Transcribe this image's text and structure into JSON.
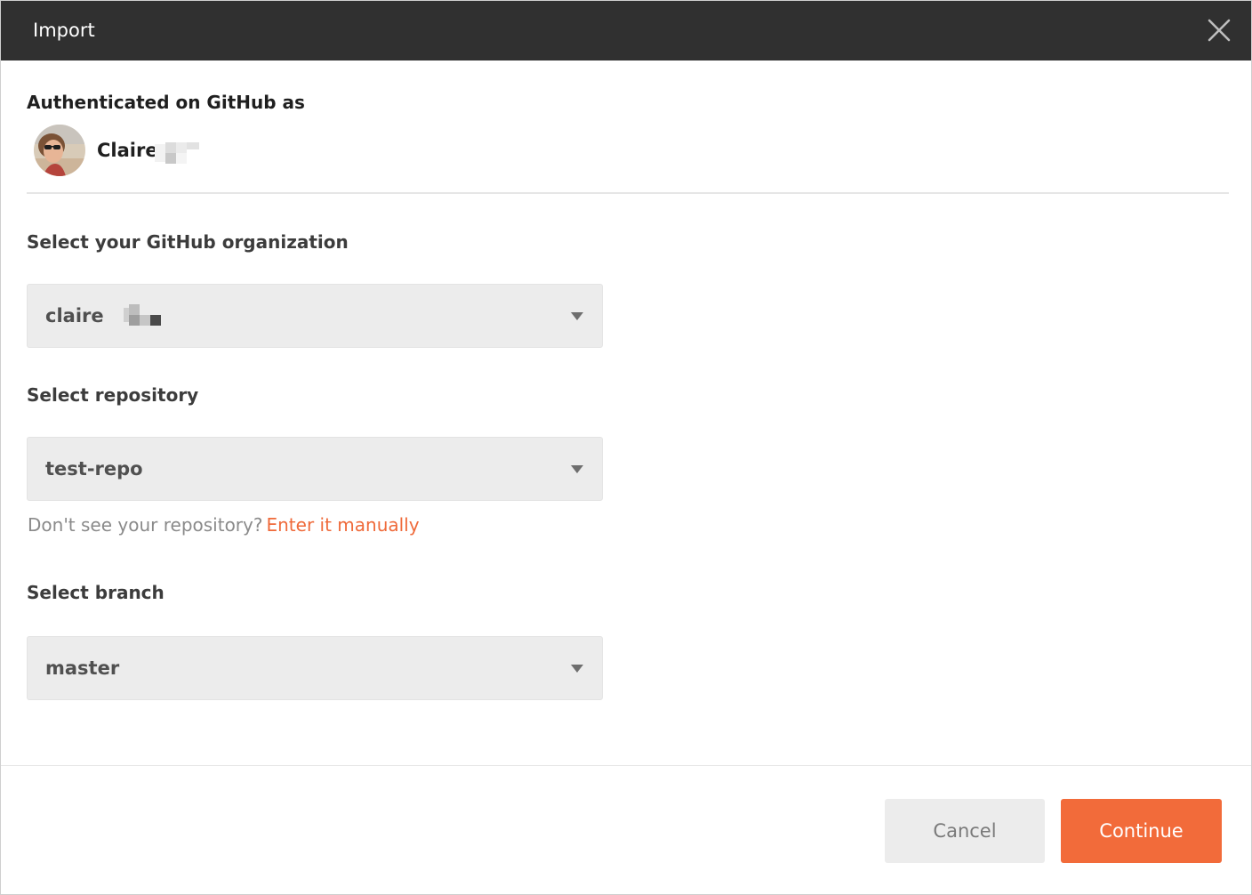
{
  "dialog": {
    "title": "Import",
    "close_icon": "close-icon"
  },
  "auth": {
    "heading": "Authenticated on GitHub as",
    "user_name": "Claire",
    "avatar_icon": "avatar"
  },
  "organization": {
    "label": "Select your GitHub organization",
    "value": "claire"
  },
  "repository": {
    "label": "Select repository",
    "value": "test-repo",
    "hint_text": "Don't see your repository?",
    "hint_link": "Enter it manually"
  },
  "branch": {
    "label": "Select branch",
    "value": "master"
  },
  "footer": {
    "cancel_label": "Cancel",
    "continue_label": "Continue"
  },
  "colors": {
    "titlebar": "#303030",
    "accent": "#f26b3a",
    "link": "#ef6a3a",
    "select_bg": "#ececec"
  }
}
